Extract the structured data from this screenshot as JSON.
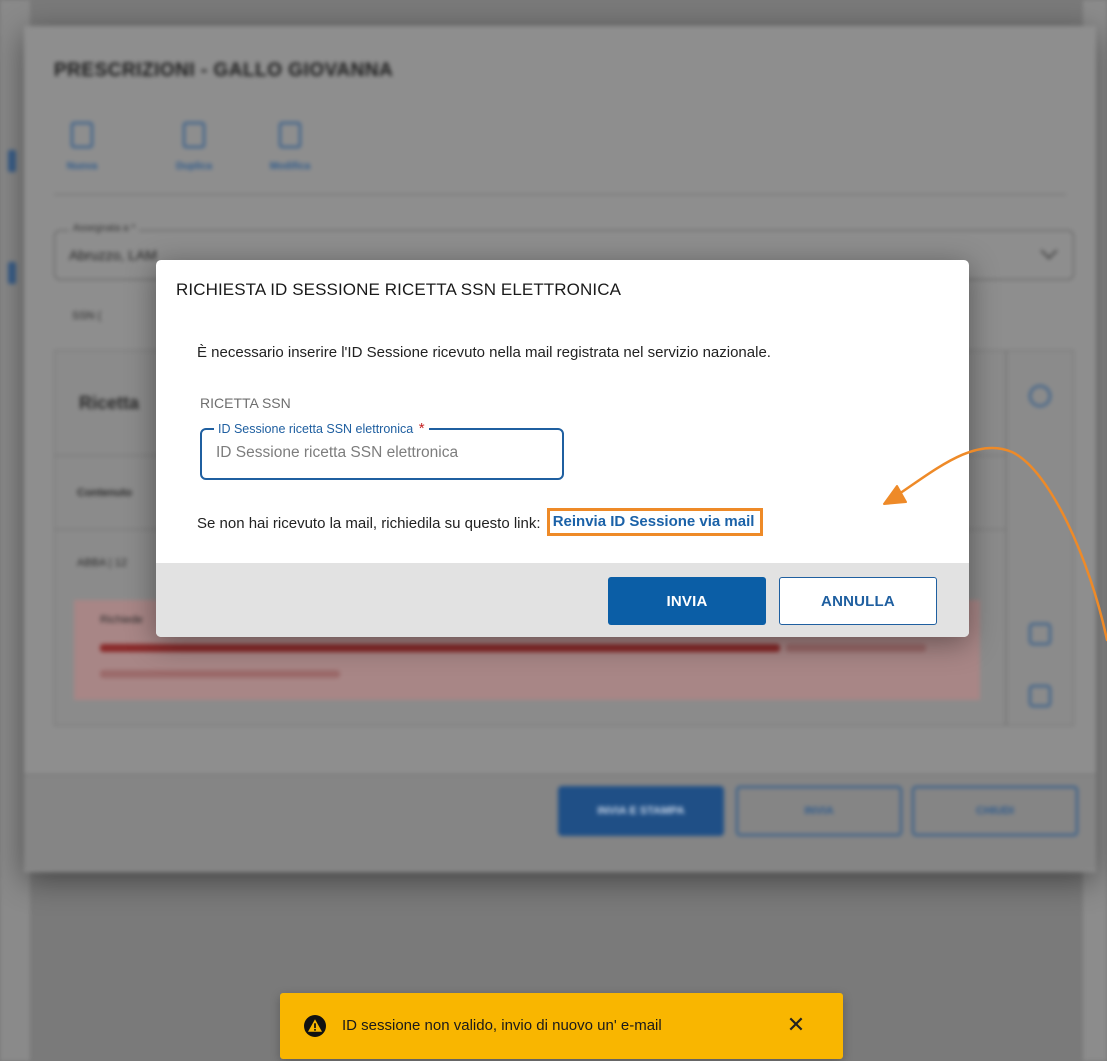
{
  "background": {
    "window_title": "PRESCRIZIONI - GALLO GIOVANNA",
    "toolbar": [
      {
        "label": "Nuova",
        "icon": "pencil-icon"
      },
      {
        "label": "Duplica",
        "icon": "document-icon"
      },
      {
        "label": "Modifica",
        "icon": "edit-document-icon"
      }
    ],
    "select_label": "Assegnata a *",
    "select_value": "Abruzzo, LAM",
    "section_toggle": "SSN (",
    "panel_heading": "Ricetta",
    "panel_col1": "Contenuto",
    "panel_row1": "ABBA | 12",
    "alert_line1": "Richiede",
    "footer_buttons": [
      "INVIA E STAMPA",
      "INVIA",
      "CHIUDI"
    ]
  },
  "modal": {
    "title": "RICHIESTA ID SESSIONE RICETTA SSN ELETTRONICA",
    "description": "È necessario inserire l'ID Sessione ricevuto nella mail registrata nel servizio nazionale.",
    "section_label": "RICETTA SSN",
    "field_label": "ID Sessione ricetta SSN elettronica",
    "field_required_mark": "*",
    "field_placeholder": "ID Sessione ricetta SSN elettronica",
    "field_value": "",
    "resend_prompt": "Se non hai ricevuto la mail, richiedila su questo link:",
    "resend_link": "Reinvia ID Sessione via mail",
    "submit_label": "INVIA",
    "cancel_label": "ANNULLA"
  },
  "toast": {
    "message": "ID sessione non valido, invio di nuovo un' e-mail",
    "close_symbol": "✕",
    "icon": "warning-icon"
  },
  "colors": {
    "primary": "#0b5ea6",
    "link": "#1b62a8",
    "highlight": "#ee8a28",
    "toast_bg": "#f9b600",
    "required": "#c41f1f"
  }
}
